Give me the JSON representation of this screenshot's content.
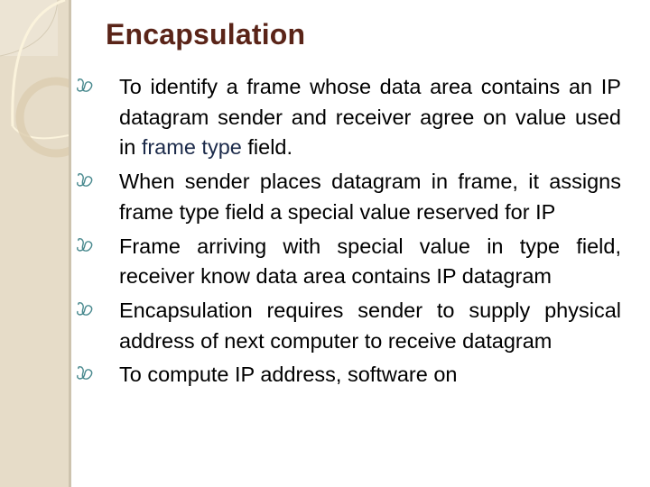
{
  "slide": {
    "title": "Encapsulation",
    "colors": {
      "title": "#5a2418",
      "highlight": "#1b2a4a",
      "bullet": "#4a8a8f",
      "sidebar": "#e6dcc8"
    },
    "bullets": [
      {
        "icon": "wingdings-swirl-bullet-icon",
        "text_before": "To identify a frame whose data area contains an IP datagram sender and receiver agree on value used in ",
        "highlight": "frame type",
        "text_after": " field."
      },
      {
        "icon": "wingdings-swirl-bullet-icon",
        "text": "When sender places datagram in frame, it assigns frame type field a special value reserved for IP"
      },
      {
        "icon": "wingdings-swirl-bullet-icon",
        "text": "Frame arriving with special value in type field, receiver know data area contains IP datagram"
      },
      {
        "icon": "wingdings-swirl-bullet-icon",
        "text": "Encapsulation requires sender to supply physical address of next computer to receive datagram"
      },
      {
        "icon": "wingdings-swirl-bullet-icon",
        "text": "To compute IP address, software on"
      }
    ]
  }
}
